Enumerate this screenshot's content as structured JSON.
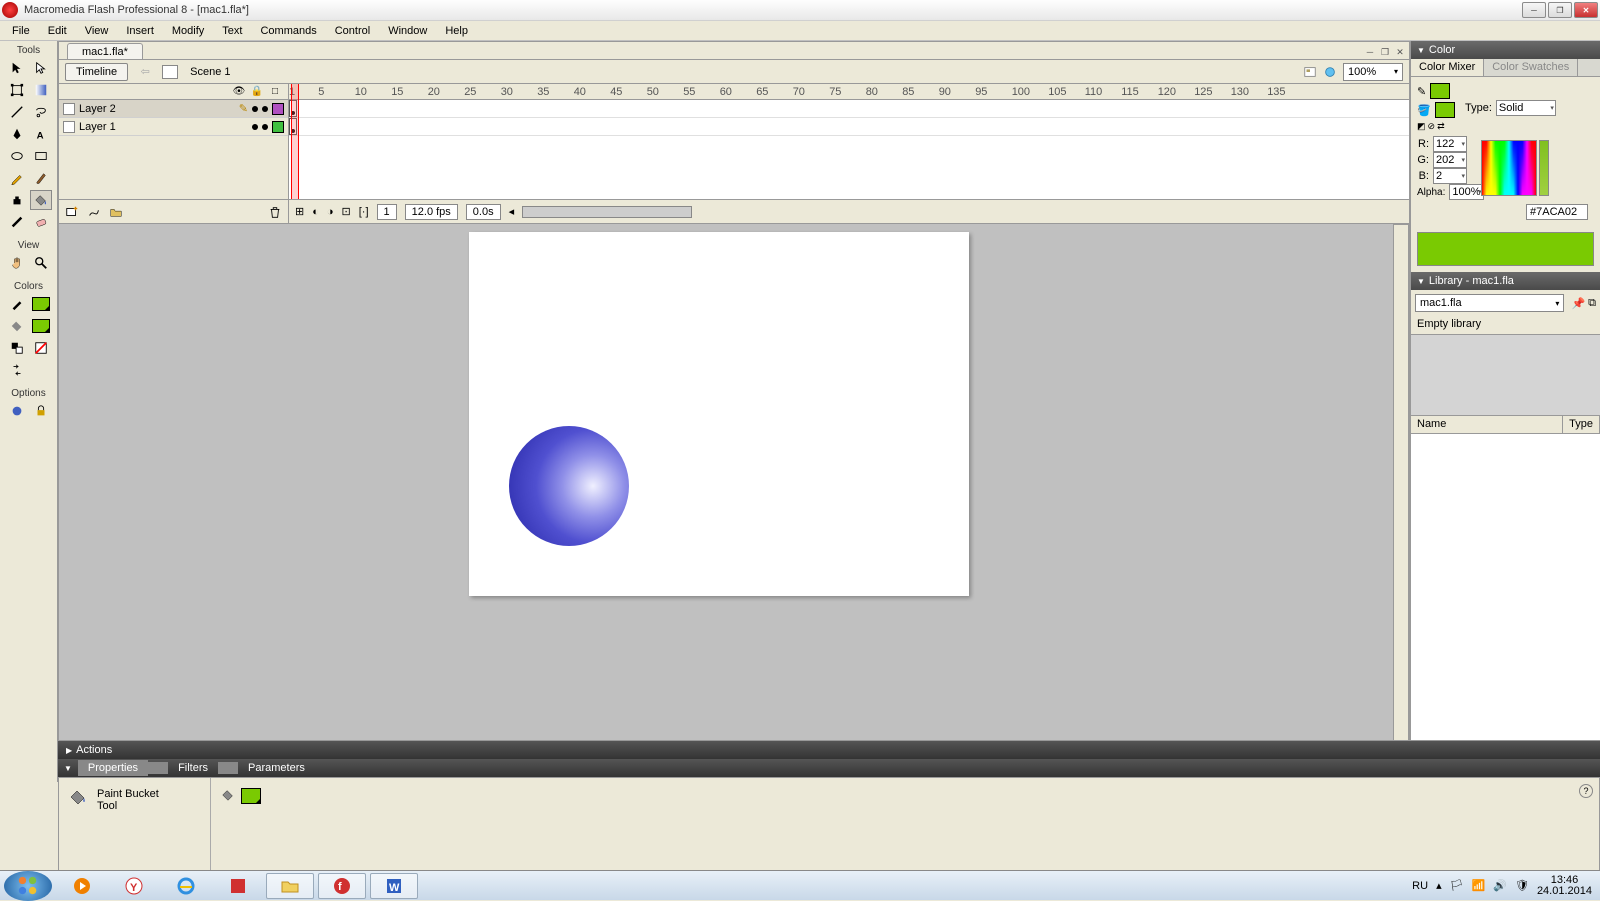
{
  "title": "Macromedia Flash Professional 8 - [mac1.fla*]",
  "menu": [
    "File",
    "Edit",
    "View",
    "Insert",
    "Modify",
    "Text",
    "Commands",
    "Control",
    "Window",
    "Help"
  ],
  "file_tab": "mac1.fla*",
  "timeline_btn": "Timeline",
  "scene": "Scene 1",
  "zoom": "100%",
  "layers": [
    {
      "name": "Layer 2",
      "sel": true,
      "color": "#b050c0"
    },
    {
      "name": "Layer 1",
      "sel": false,
      "color": "#40c040"
    }
  ],
  "ruler_ticks": [
    "1",
    "5",
    "10",
    "15",
    "20",
    "25",
    "30",
    "35",
    "40",
    "45",
    "50",
    "55",
    "60",
    "65",
    "70",
    "75",
    "80",
    "85",
    "90",
    "95",
    "100",
    "105",
    "110",
    "115",
    "120",
    "125",
    "130",
    "135"
  ],
  "frame_current": "1",
  "fps": "12.0 fps",
  "elapsed": "0.0s",
  "tools_label": "Tools",
  "view_label": "View",
  "colors_label": "Colors",
  "options_label": "Options",
  "actions_label": "Actions",
  "prop_tabs": [
    "Properties",
    "Filters",
    "Parameters"
  ],
  "prop_tool": "Paint Bucket",
  "prop_tool2": "Tool",
  "color_panel": "Color",
  "mixer_tabs": [
    "Color Mixer",
    "Color Swatches"
  ],
  "type_label": "Type:",
  "type_value": "Solid",
  "rgba": {
    "r_l": "R:",
    "r": "122",
    "g_l": "G:",
    "g": "202",
    "b_l": "B:",
    "b": "2",
    "a_l": "Alpha:",
    "a": "100%"
  },
  "hex": "#7ACA02",
  "accent": "#7ACA02",
  "library_title": "Library - mac1.fla",
  "library_doc": "mac1.fla",
  "library_empty": "Empty library",
  "lib_cols": {
    "name": "Name",
    "type": "Type"
  },
  "tray": {
    "lang": "RU",
    "time": "13:46",
    "date": "24.01.2014"
  }
}
